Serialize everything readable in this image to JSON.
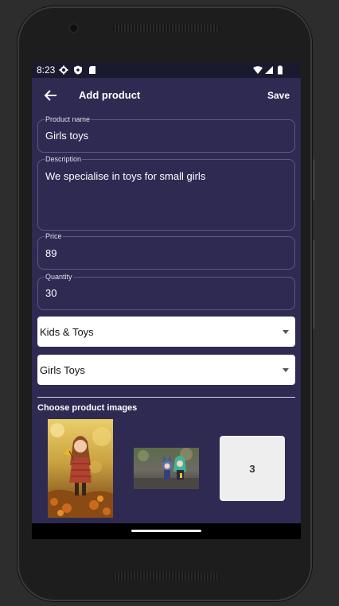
{
  "status_bar": {
    "time": "8:23",
    "left_icons": [
      "gear-icon",
      "shield-icon",
      "sd-card-icon"
    ],
    "right_icons": [
      "wifi-icon",
      "signal-icon",
      "battery-icon"
    ]
  },
  "app_bar": {
    "title": "Add product",
    "save_label": "Save",
    "back_icon": "arrow-left-icon"
  },
  "form": {
    "product_name": {
      "label": "Product name",
      "value": "Girls toys"
    },
    "description": {
      "label": "Description",
      "value": "We specialise in toys for small girls"
    },
    "price": {
      "label": "Price",
      "value": "89"
    },
    "quantity": {
      "label": "Quantity",
      "value": "30"
    },
    "category": {
      "selected": "Kids & Toys"
    },
    "subcategory": {
      "selected": "Girls Toys"
    }
  },
  "images_section": {
    "title": "Choose product images",
    "images": [
      {
        "name": "doll-autumn-photo"
      },
      {
        "name": "anime-figures-photo"
      }
    ],
    "slot_label": "3"
  },
  "colors": {
    "screen_bg": "#2e2a52",
    "status_bg": "#1a1a2e",
    "field_border": "#5c5888",
    "text": "#ffffff"
  }
}
